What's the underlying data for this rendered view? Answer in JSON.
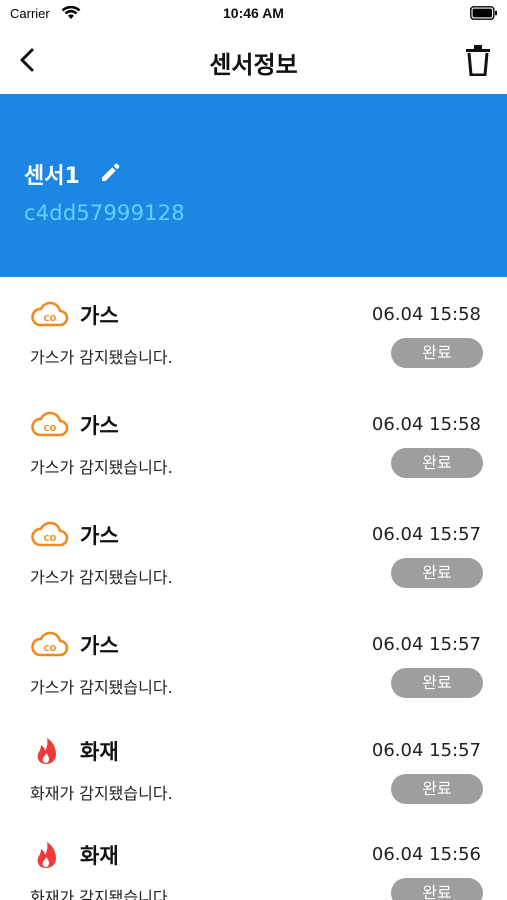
{
  "status_bar": {
    "carrier": "Carrier",
    "time": "10:46 AM"
  },
  "nav": {
    "title": "센서정보"
  },
  "sensor": {
    "name": "센서1",
    "id": "c4dd57999128"
  },
  "colors": {
    "header_bg": "#1d86e3",
    "sensor_id": "#5fd3ff",
    "gas_icon": "#f08a1c",
    "fire_icon": "#f03a3a",
    "done_button": "#9e9e9e"
  },
  "events": [
    {
      "type": "gas",
      "icon": "co-cloud-icon",
      "title": "가스",
      "time": "06.04 15:58",
      "message": "가스가 감지됐습니다.",
      "status": "완료"
    },
    {
      "type": "gas",
      "icon": "co-cloud-icon",
      "title": "가스",
      "time": "06.04 15:58",
      "message": "가스가 감지됐습니다.",
      "status": "완료"
    },
    {
      "type": "gas",
      "icon": "co-cloud-icon",
      "title": "가스",
      "time": "06.04 15:57",
      "message": "가스가 감지됐습니다.",
      "status": "완료"
    },
    {
      "type": "gas",
      "icon": "co-cloud-icon",
      "title": "가스",
      "time": "06.04 15:57",
      "message": "가스가 감지됐습니다.",
      "status": "완료"
    },
    {
      "type": "fire",
      "icon": "flame-icon",
      "title": "화재",
      "time": "06.04 15:57",
      "message": "화재가 감지됐습니다.",
      "status": "완료"
    },
    {
      "type": "fire",
      "icon": "flame-icon",
      "title": "화재",
      "time": "06.04 15:56",
      "message": "화재가 감지됐습니다.",
      "status": "완료"
    }
  ]
}
